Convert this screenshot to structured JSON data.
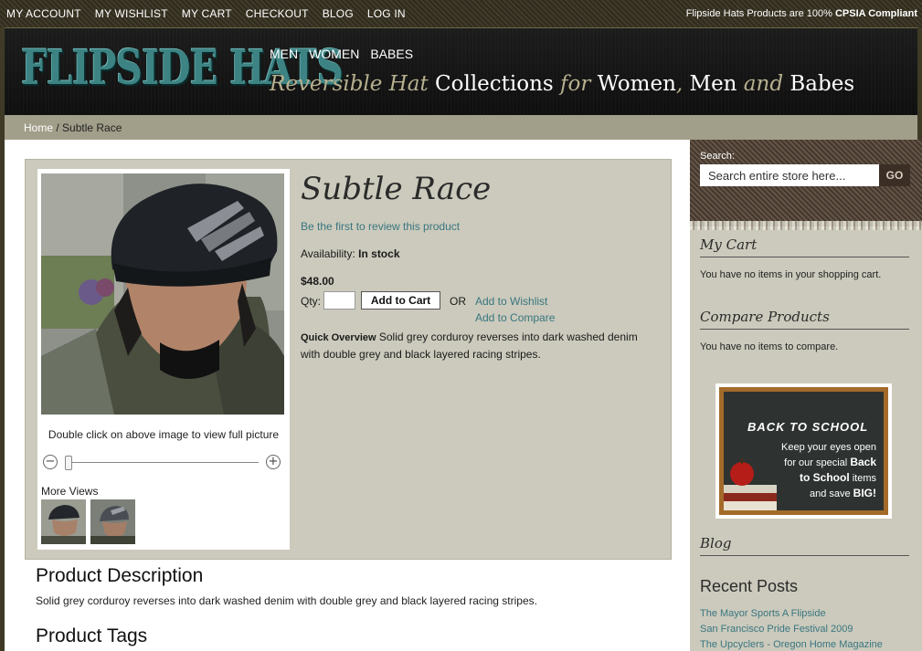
{
  "topbar": {
    "links": [
      "MY ACCOUNT",
      "MY WISHLIST",
      "MY CART",
      "CHECKOUT",
      "BLOG",
      "LOG IN"
    ],
    "compliance_prefix": "Flipside Hats Products are 100% ",
    "compliance_bold": "CPSIA Compliant"
  },
  "header": {
    "logo": "FLIPSIDE HATS",
    "nav": [
      "MEN",
      "WOMEN",
      "BABES"
    ],
    "tagline": {
      "p1": "Reversible Hat ",
      "p2": "Collections",
      "p3": " for ",
      "p4": "Women",
      "p5": ", ",
      "p6": "Men",
      "p7": " and ",
      "p8": "Babes"
    }
  },
  "breadcrumb": {
    "home": "Home",
    "separator": " / ",
    "current": "Subtle Race"
  },
  "product": {
    "title": "Subtle Race",
    "review_link": "Be the first to review this product",
    "availability_label": "Availability: ",
    "availability_value": "In stock",
    "price": "$48.00",
    "qty_label": "Qty:",
    "qty_value": "",
    "add_to_cart": "Add to Cart",
    "or": "OR",
    "add_to_wishlist": "Add to Wishlist",
    "add_to_compare": "Add to Compare",
    "overview_label": "Quick Overview",
    "overview_text": " Solid grey corduroy reverses into dark washed denim with double grey and black layered racing stripes.",
    "zoom_hint": "Double click on above image to view full picture",
    "zoom_out": "−",
    "zoom_in": "+",
    "more_views": "More Views"
  },
  "description": {
    "heading": "Product Description",
    "text": "Solid grey corduroy reverses into dark washed denim with double grey and black layered racing stripes.",
    "tags_heading": "Product Tags"
  },
  "sidebar": {
    "search_label": "Search:",
    "search_placeholder": "Search entire store here...",
    "search_button": "GO",
    "cart_title": "My Cart",
    "cart_text": "You have no items in your shopping cart.",
    "compare_title": "Compare Products",
    "compare_text": "You have no items to compare.",
    "promo": {
      "headline": "BACK TO SCHOOL",
      "t1": "Keep your eyes open",
      "t2": "for our special ",
      "t3": "Back",
      "t4": "to School",
      "t5": " items",
      "t6": "and save ",
      "t7": "BIG!"
    },
    "blog_title": "Blog",
    "recent_title": "Recent Posts",
    "posts": [
      "The Mayor Sports A Flipside",
      "San Francisco Pride Festival 2009",
      "The Upcyclers - Oregon Home Magazine"
    ]
  }
}
